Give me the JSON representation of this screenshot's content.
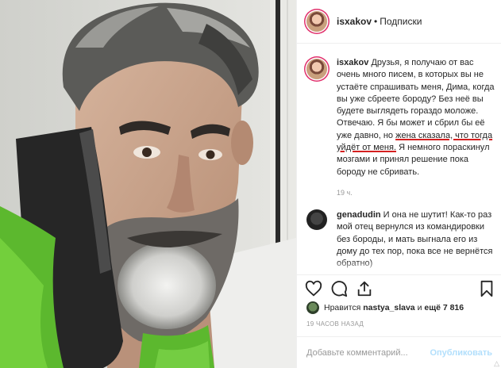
{
  "post": {
    "author": "isxakov",
    "separator": "•",
    "follow_label": "Подписки"
  },
  "caption": {
    "username": "isxakov",
    "text_before": "Друзья, я получаю от вас очень много писем, в которых вы не устаёте спрашивать меня, Дима, когда вы уже сбреете бороду? Без неё вы будете выглядеть гораздо моложе. Отвечаю. Я бы может и сбрил бы её уже давно, но ",
    "text_underlined": "жена сказала, что тогда уйдёт от меня.",
    "text_after": " Я немного пораскинул мозгами и принял решение пока бороду не сбривать.",
    "time": "19 ч."
  },
  "comment": {
    "username": "genadudin",
    "text": "И она не шутит! Как-то раз мой отец вернулся из командировки без бороды, и мать выгнала его из дому до тех пор, пока все не вернётся обратно)"
  },
  "likes": {
    "prefix": "Нравится",
    "user": "nastya_slava",
    "connector": "и",
    "others": "ещё 7 816"
  },
  "timestamp": "19 ЧАСОВ НАЗАД",
  "add_comment": {
    "placeholder": "Добавьте комментарий...",
    "publish_label": "Опубликовать"
  },
  "icons": {
    "like": "heart-icon",
    "comment": "comment-icon",
    "share": "share-icon",
    "save": "bookmark-icon"
  },
  "colors": {
    "text": "#262626",
    "secondary": "#999999",
    "publish_disabled": "#b2dffc",
    "story_ring": "#e1306c",
    "underline": "#d42020",
    "towel": "#5cb82e"
  }
}
